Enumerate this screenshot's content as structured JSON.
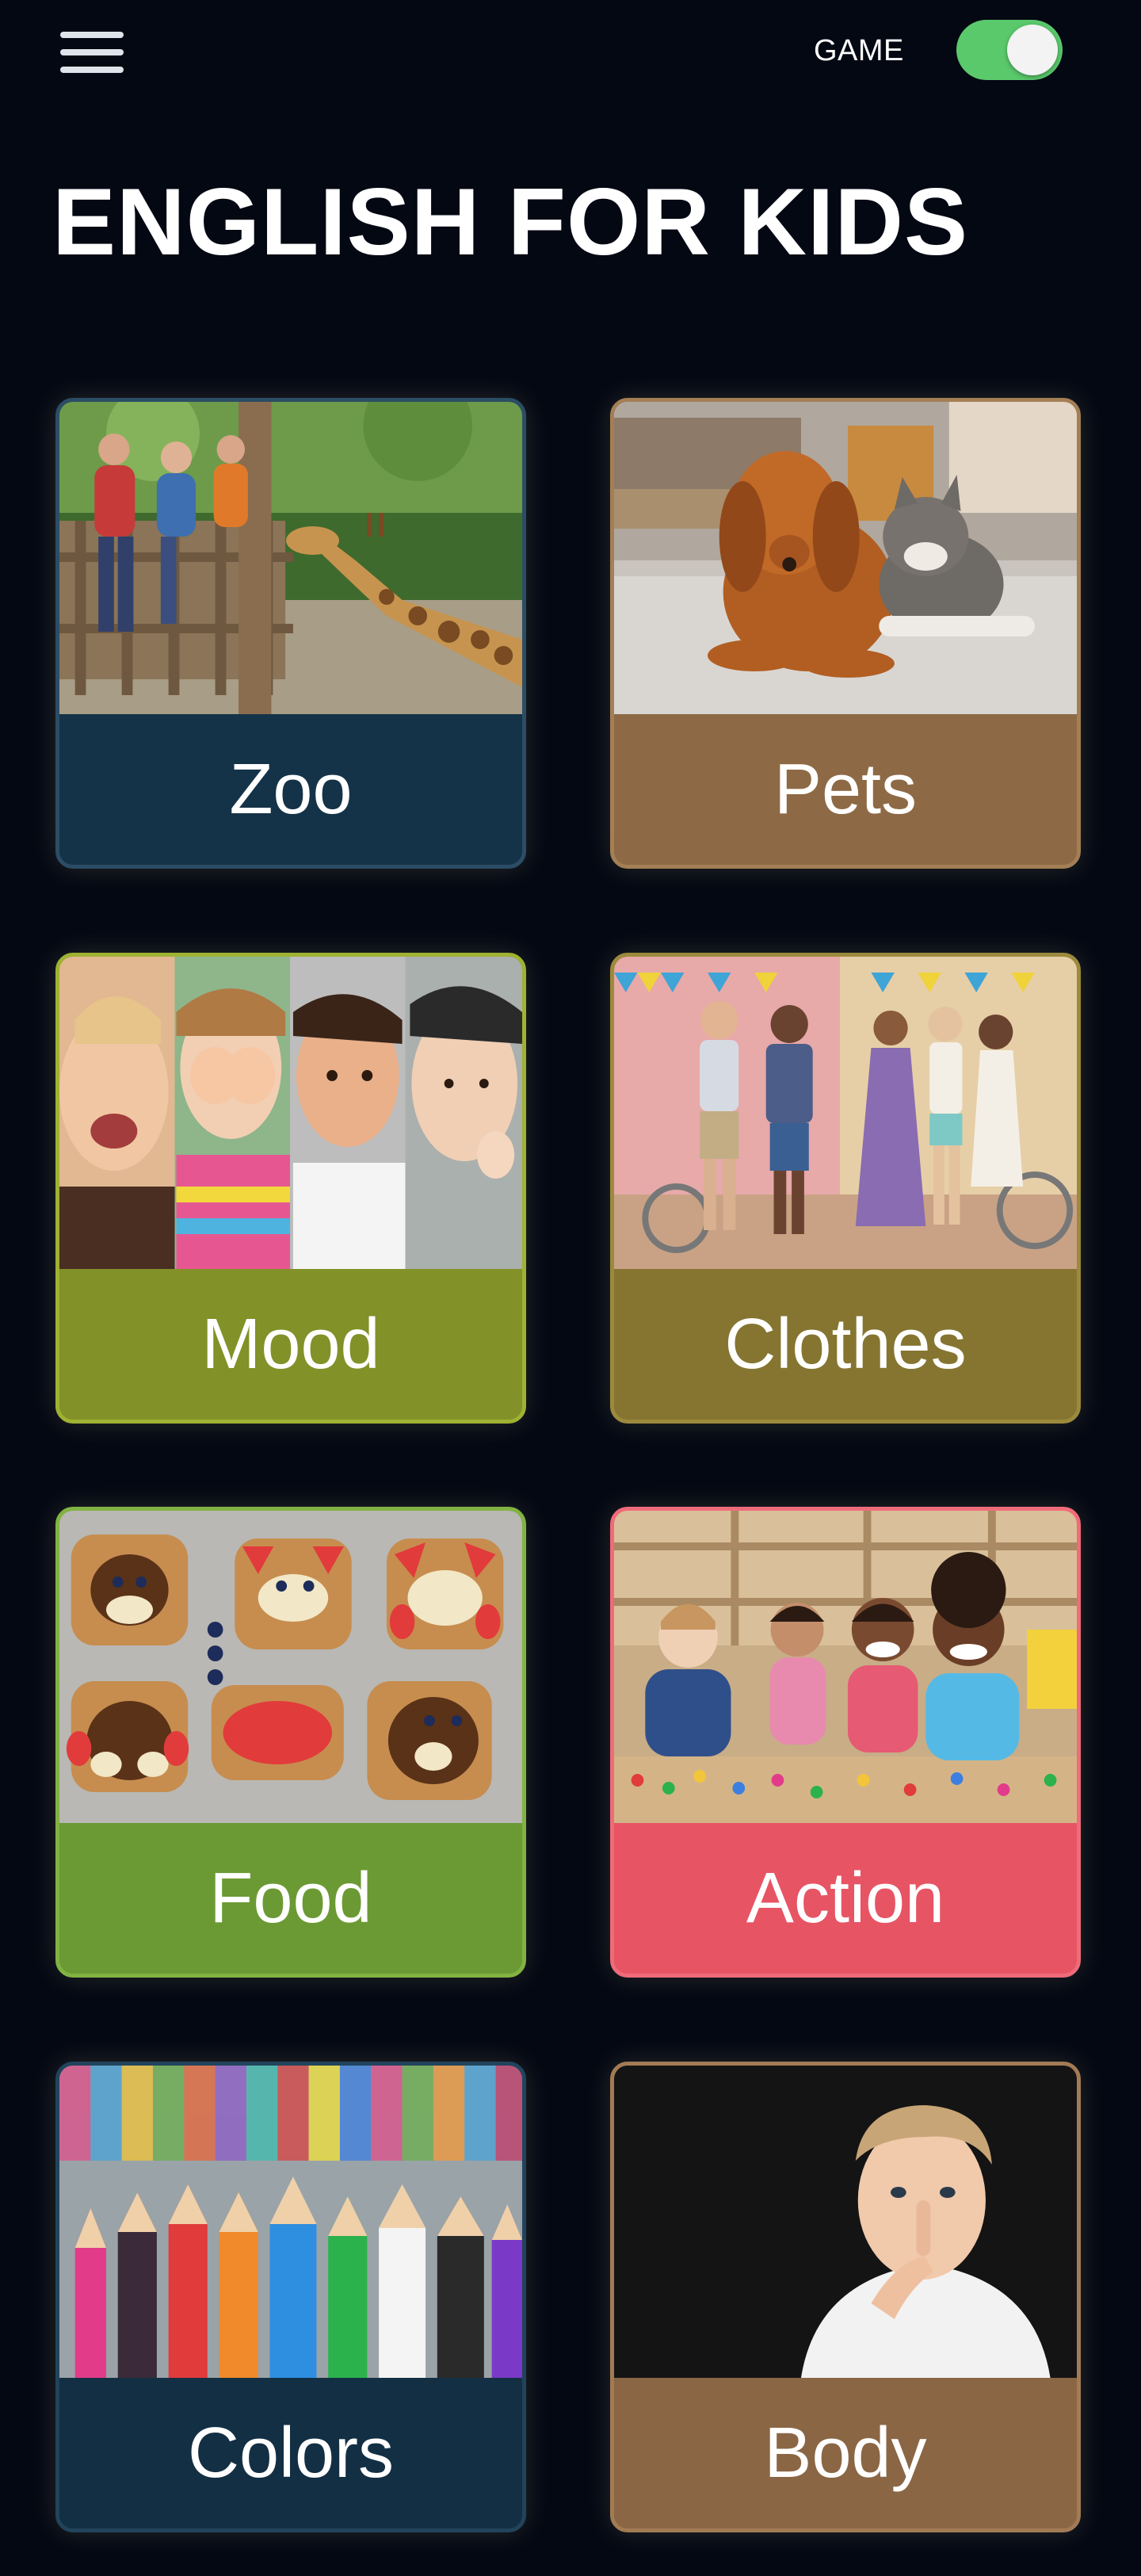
{
  "header": {
    "menu_icon": "hamburger-menu-icon",
    "mode_label": "GAME",
    "mode_toggle_on": true,
    "toggle_color": "#5ac96c"
  },
  "title": "ENGLISH FOR KIDS",
  "categories": [
    {
      "label": "Zoo",
      "color": "#153348",
      "border": "#2b4d66",
      "image": "children-feeding-giraffe"
    },
    {
      "label": "Pets",
      "color": "#8d6a45",
      "border": "#a47f55",
      "image": "dog-and-cat"
    },
    {
      "label": "Mood",
      "color": "#829128",
      "border": "#9fb232",
      "image": "children-faces-emotions"
    },
    {
      "label": "Clothes",
      "color": "#857531",
      "border": "#9c8a3c",
      "image": "kids-fashion"
    },
    {
      "label": "Food",
      "color": "#6b9a34",
      "border": "#82b342",
      "image": "animal-face-toasts"
    },
    {
      "label": "Action",
      "color": "#e75464",
      "border": "#f06b7a",
      "image": "kids-playing-at-table"
    },
    {
      "label": "Colors",
      "color": "#132f44",
      "border": "#21445c",
      "image": "colored-pencils"
    },
    {
      "label": "Body",
      "color": "#8a6644",
      "border": "#a27b55",
      "image": "boy-thinking"
    }
  ]
}
